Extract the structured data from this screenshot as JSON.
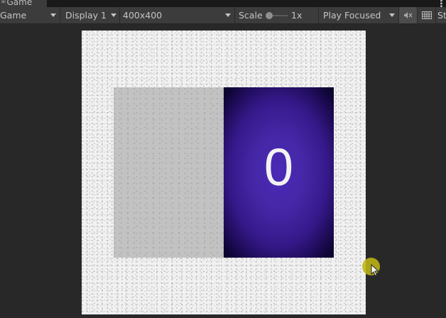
{
  "tab": {
    "icon": "game-controller-icon",
    "label": "Game",
    "menu_icon": "kebab-menu-icon"
  },
  "toolbar": {
    "view_mode": "Game",
    "display": "Display 1",
    "resolution": "400x400",
    "scale_label": "Scale",
    "scale_value": "1x",
    "scale_fraction": 0.0,
    "play_mode": "Play Focused",
    "mute_icon": "mute-audio-icon",
    "stats_icon": "keyboard-grid-icon",
    "overflow_label": "St"
  },
  "game": {
    "card_value": "0",
    "colors": {
      "background": "#f1f1f1",
      "gray_panel": "#c2c2c2",
      "card_center": "#4a2ab8",
      "card_edge": "#0c0530"
    }
  }
}
